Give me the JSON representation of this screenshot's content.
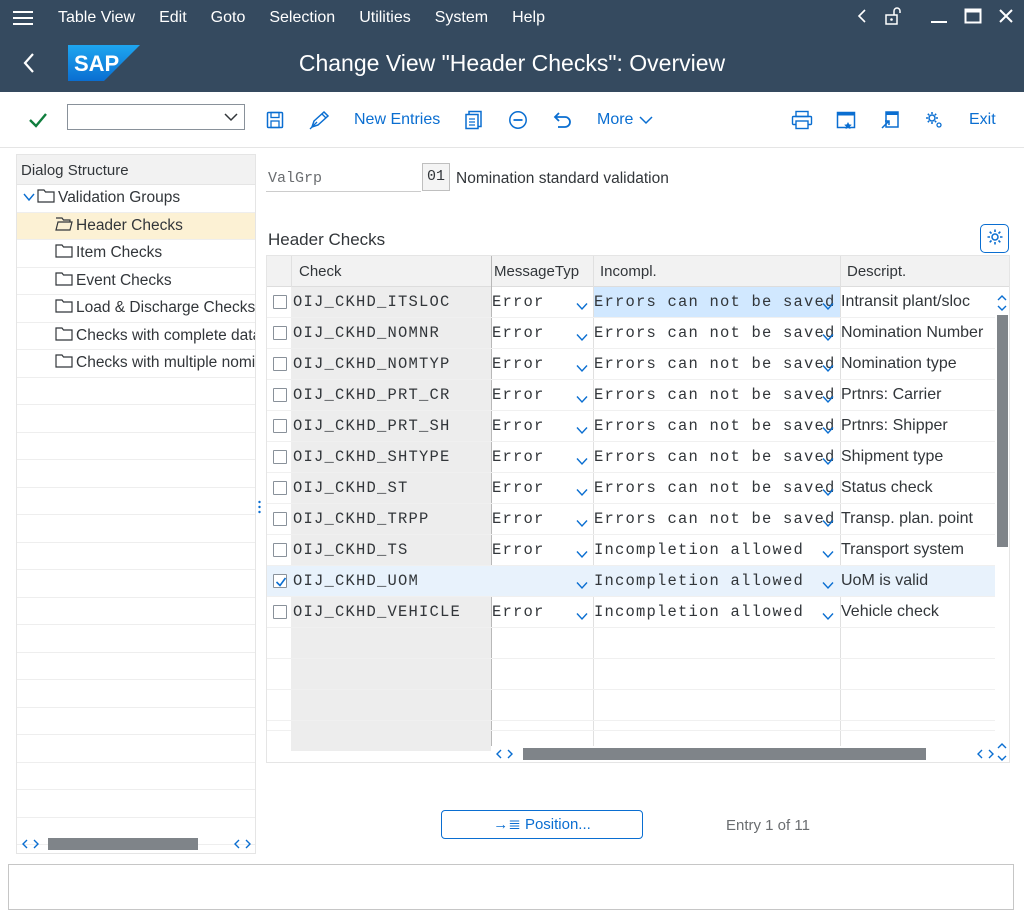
{
  "menubar": {
    "items": [
      "Table View",
      "Edit",
      "Goto",
      "Selection",
      "Utilities",
      "System",
      "Help"
    ]
  },
  "titlebar": {
    "logo_text": "SAP",
    "title": "Change View \"Header Checks\": Overview"
  },
  "toolbar": {
    "command_field_value": "",
    "new_entries_label": "New Entries",
    "more_label": "More",
    "exit_label": "Exit"
  },
  "dialog_structure": {
    "header": "Dialog Structure",
    "items": [
      {
        "label": "Validation Groups"
      },
      {
        "label": "Header Checks"
      },
      {
        "label": "Item Checks"
      },
      {
        "label": "Event Checks"
      },
      {
        "label": "Load & Discharge Checks"
      },
      {
        "label": "Checks with complete data"
      },
      {
        "label": "Checks with multiple nominations"
      }
    ]
  },
  "valgrp": {
    "label": "ValGrp",
    "value": "01",
    "description": "Nomination standard validation"
  },
  "section_title": "Header Checks",
  "table": {
    "columns": [
      "Check",
      "MessageTyp",
      "Incompl.",
      "Descript."
    ],
    "rows": [
      {
        "checked": false,
        "check": "OIJ_CKHD_ITSLOC",
        "msgtype": "Error",
        "incompl": "Errors can not be saved",
        "descript": "Intransit plant/sloc"
      },
      {
        "checked": false,
        "check": "OIJ_CKHD_NOMNR",
        "msgtype": "Error",
        "incompl": "Errors can not be saved",
        "descript": "Nomination Number"
      },
      {
        "checked": false,
        "check": "OIJ_CKHD_NOMTYP",
        "msgtype": "Error",
        "incompl": "Errors can not be saved",
        "descript": "Nomination type"
      },
      {
        "checked": false,
        "check": "OIJ_CKHD_PRT_CR",
        "msgtype": "Error",
        "incompl": "Errors can not be saved",
        "descript": "Prtnrs: Carrier"
      },
      {
        "checked": false,
        "check": "OIJ_CKHD_PRT_SH",
        "msgtype": "Error",
        "incompl": "Errors can not be saved",
        "descript": "Prtnrs: Shipper"
      },
      {
        "checked": false,
        "check": "OIJ_CKHD_SHTYPE",
        "msgtype": "Error",
        "incompl": "Errors can not be saved",
        "descript": "Shipment type"
      },
      {
        "checked": false,
        "check": "OIJ_CKHD_ST",
        "msgtype": "Error",
        "incompl": "Errors can not be saved",
        "descript": "Status check"
      },
      {
        "checked": false,
        "check": "OIJ_CKHD_TRPP",
        "msgtype": "Error",
        "incompl": "Errors can not be saved",
        "descript": "Transp. plan. point"
      },
      {
        "checked": false,
        "check": "OIJ_CKHD_TS",
        "msgtype": "Error",
        "incompl": "Incompletion allowed",
        "descript": "Transport system"
      },
      {
        "checked": true,
        "check": "OIJ_CKHD_UOM",
        "msgtype": "",
        "incompl": "Incompletion allowed",
        "descript": "UoM is valid"
      },
      {
        "checked": false,
        "check": "OIJ_CKHD_VEHICLE",
        "msgtype": "Error",
        "incompl": "Incompletion allowed",
        "descript": "Vehicle check"
      }
    ]
  },
  "position_button": "Position...",
  "entry_text": "Entry 1 of 11",
  "colors": {
    "shell": "#354a5f",
    "accent": "#0a6ed1",
    "selected_tree": "#fcf1d4",
    "selected_row": "#e8f2fc"
  }
}
